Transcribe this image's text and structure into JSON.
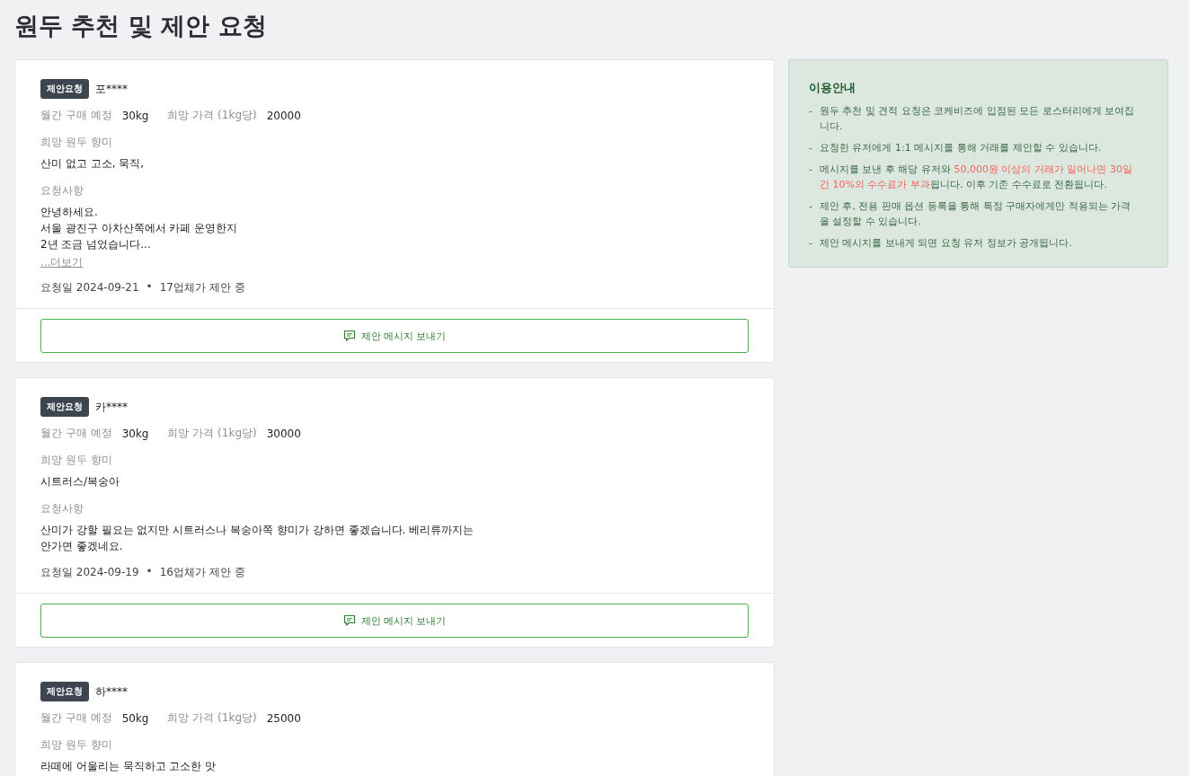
{
  "page_title": "원두 추천 및 제안 요청",
  "requests": [
    {
      "badge": "제안요청",
      "user": "포****",
      "monthly_label": "월간 구매 예정",
      "monthly_value": "30kg",
      "price_label": "희망 가격 (1kg당)",
      "price_value": "20000",
      "flavor_label": "희망 원두 향미",
      "flavor_value": "산미 없고 고소, 묵직,",
      "request_label": "요청사항",
      "request_lines": [
        "안녕하세요.",
        "서울 광진구 아차산쪽에서 카페 운영한지",
        "2년 조금 넘었습니다..."
      ],
      "more_link": "...더보기",
      "date": "요청일 2024-09-21",
      "separator": "•",
      "offers": "17업체가 제안 중",
      "button": "제안 메시지 보내기"
    },
    {
      "badge": "제안요청",
      "user": "카****",
      "monthly_label": "월간 구매 예정",
      "monthly_value": "30kg",
      "price_label": "희망 가격 (1kg당)",
      "price_value": "30000",
      "flavor_label": "희망 원두 향미",
      "flavor_value": "시트러스/복숭아",
      "request_label": "요청사항",
      "request_lines": [
        "산미가 강할 필요는 없지만 시트러스나 복숭아쪽 향미가 강하면 좋겠습니다. 베리류까지는",
        "안가면 좋겠네요."
      ],
      "date": "요청일 2024-09-19",
      "separator": "•",
      "offers": "16업체가 제안 중",
      "button": "제안 메시지 보내기"
    },
    {
      "badge": "제안요청",
      "user": "하****",
      "monthly_label": "월간 구매 예정",
      "monthly_value": "50kg",
      "price_label": "희망 가격 (1kg당)",
      "price_value": "25000",
      "flavor_label": "희망 원두 향미",
      "flavor_value": "라떼에 어울리는 묵직하고 고소한 맛"
    }
  ],
  "guide": {
    "title": "이용안내",
    "items": [
      {
        "bullet": "-",
        "segments": [
          {
            "text": "원두 추천 및 견적 요청은 코케비즈에 입점된 모든 로스터리에게 보여집니다.",
            "highlight": false
          }
        ]
      },
      {
        "bullet": "-",
        "segments": [
          {
            "text": "요청한 유저에게 1:1 메시지를 통해 거래를 제안할 수 있습니다.",
            "highlight": false
          }
        ]
      },
      {
        "bullet": "-",
        "segments": [
          {
            "text": "메시지를 보낸 후 해당 유저와 ",
            "highlight": false
          },
          {
            "text": "50,000원 이상의 거래가 일어나면 30일간 10%의 수수료가 부과",
            "highlight": true
          },
          {
            "text": "됩니다. 이후 기존 수수료로 전환됩니다.",
            "highlight": false
          }
        ]
      },
      {
        "bullet": "-",
        "segments": [
          {
            "text": "제안 후, 전용 판매 옵션 등록을 통해 특정 구매자에게만 적용되는 가격을 설정할 수 있습니다.",
            "highlight": false
          }
        ]
      },
      {
        "bullet": "-",
        "segments": [
          {
            "text": "제안 메시지를 보내게 되면 요청 유저 정보가 공개됩니다.",
            "highlight": false
          }
        ]
      }
    ]
  }
}
